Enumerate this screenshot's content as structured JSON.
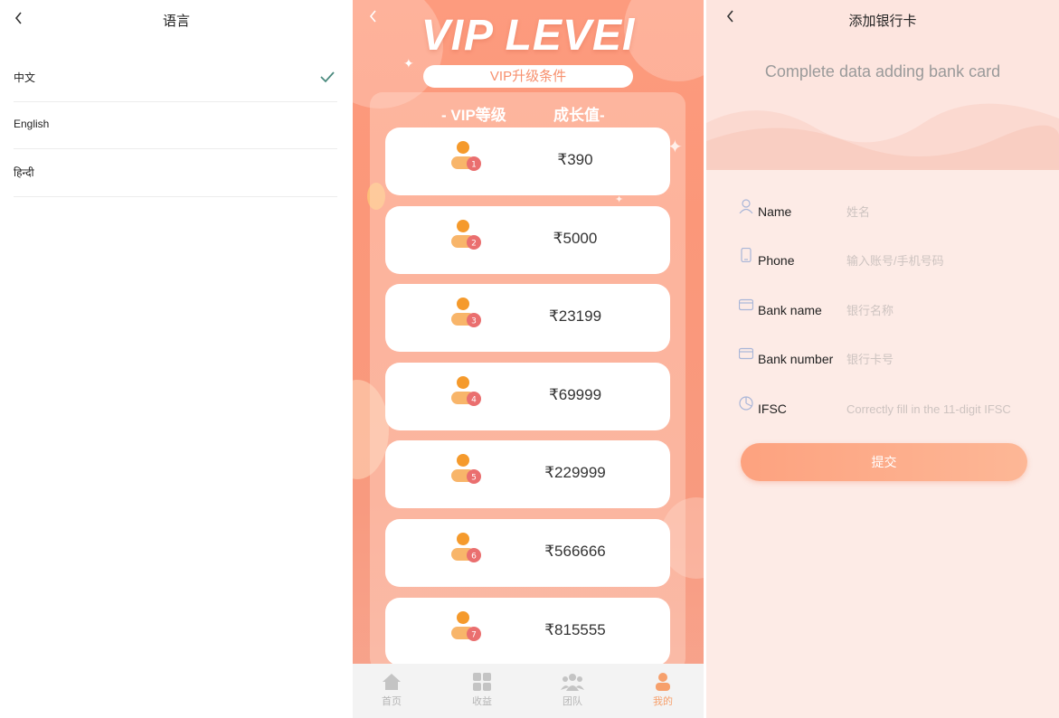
{
  "language_page": {
    "back_icon": "chevron-left-icon",
    "title": "语言",
    "languages": [
      {
        "label": "中文",
        "selected": true
      },
      {
        "label": "English",
        "selected": false
      },
      {
        "label": "हिन्दी",
        "selected": false
      }
    ],
    "check_color": "#4a8a7e"
  },
  "vip_page": {
    "back_icon": "chevron-left-icon",
    "title": "VIP LEVEl",
    "subtitle": "VIP升级条件",
    "header_level": "- VIP等级",
    "header_growth": "成长值-",
    "levels": [
      {
        "level": "1",
        "amount": "₹390"
      },
      {
        "level": "2",
        "amount": "₹5000"
      },
      {
        "level": "3",
        "amount": "₹23199"
      },
      {
        "level": "4",
        "amount": "₹69999"
      },
      {
        "level": "5",
        "amount": "₹229999"
      },
      {
        "level": "6",
        "amount": "₹566666"
      },
      {
        "level": "7",
        "amount": "₹815555"
      }
    ],
    "tabs": [
      {
        "label": "首页",
        "icon": "home-icon",
        "active": false
      },
      {
        "label": "收益",
        "icon": "grid-icon",
        "active": false
      },
      {
        "label": "团队",
        "icon": "team-icon",
        "active": false
      },
      {
        "label": "我的",
        "icon": "user-icon",
        "active": true
      }
    ],
    "accent_color": "#f6a06c"
  },
  "bank_page": {
    "back_icon": "chevron-left-icon",
    "title": "添加银行卡",
    "subtitle": "Complete data adding bank card",
    "fields": [
      {
        "label": "Name",
        "placeholder": "姓名",
        "icon": "person-icon"
      },
      {
        "label": "Phone",
        "placeholder": "输入账号/手机号码",
        "icon": "phone-icon"
      },
      {
        "label": "Bank name",
        "placeholder": "银行名称",
        "icon": "card-icon"
      },
      {
        "label": "Bank number",
        "placeholder": "银行卡号",
        "icon": "card-icon"
      },
      {
        "label": "IFSC",
        "placeholder": "Correctly fill in the 11-digit IFSC",
        "icon": "pie-icon"
      }
    ],
    "submit_label": "提交"
  }
}
